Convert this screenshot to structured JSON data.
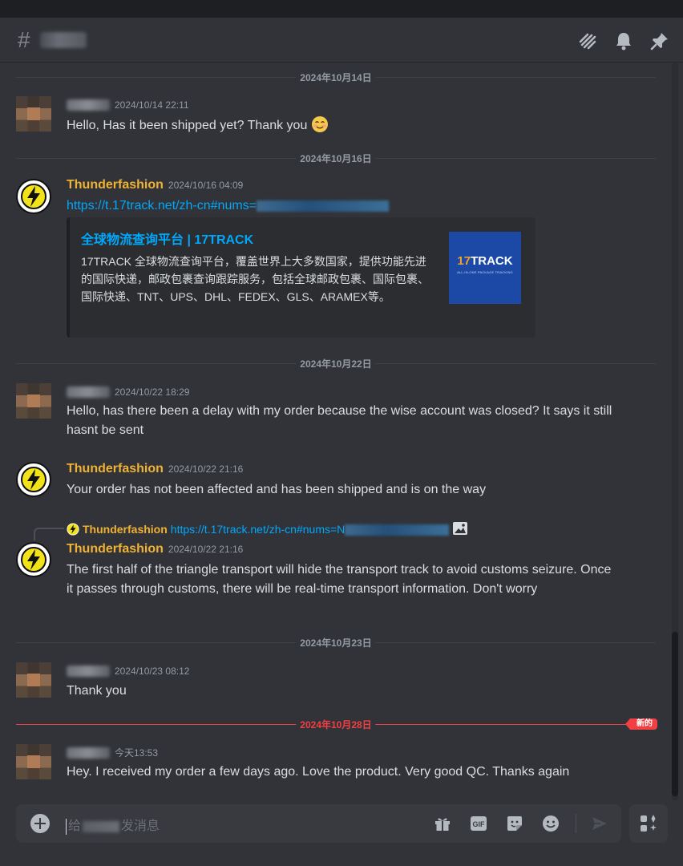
{
  "channel": {
    "hash": "#"
  },
  "messages": [
    {
      "date": "2024年10月14日",
      "timestamp": "2024/10/14 22:11",
      "text": "Hello, Has it been shipped yet? Thank you"
    },
    {
      "date": "2024年10月16日",
      "username": "Thunderfashion",
      "timestamp": "2024/10/16 04:09",
      "link": "https://t.17track.net/zh-cn#nums=",
      "embed": {
        "title": "全球物流查询平台 | 17TRACK",
        "description": "17TRACK 全球物流查询平台，覆盖世界上大多数国家，提供功能先进的国际快递，邮政包裹查询跟踪服务，包括全球邮政包裹、国际包裹、国际快递、TNT、UPS、DHL、FEDEX、GLS、ARAMEX等。",
        "thumb_logo_a": "17",
        "thumb_logo_b": "TRACK",
        "thumb_sub": "ALL-IN-ONE PACKAGE TRACKING"
      }
    },
    {
      "date": "2024年10月22日",
      "timestamp": "2024/10/22 18:29",
      "text": "Hello,  has there been a delay with my order because the wise account was closed? It says it still hasnt be sent"
    },
    {
      "username": "Thunderfashion",
      "timestamp": "2024/10/22 21:16",
      "text": "Your order has not been affected and has been shipped and is on the way"
    },
    {
      "reply": {
        "username": "Thunderfashion",
        "link": "https://t.17track.net/zh-cn#nums=N"
      },
      "username": "Thunderfashion",
      "timestamp": "2024/10/22 21:16",
      "text": "The first half of the triangle transport will hide the transport track to avoid customs seizure. Once it passes through customs, there will be real-time transport information. Don't worry"
    },
    {
      "date": "2024年10月23日",
      "timestamp": "2024/10/23 08:12",
      "text": "Thank you"
    },
    {
      "date": "2024年10月28日",
      "new_label": "新的",
      "timestamp": "今天13:53",
      "text": "Hey. I received my order a few days ago. Love the product. Very good QC. Thanks again"
    }
  ],
  "composer": {
    "placeholder_start": "给",
    "placeholder_end": "发消息"
  },
  "colors": {
    "accent_link": "#00a8fc",
    "username": "#f0b232",
    "new_divider": "#f23f43",
    "background": "#313338"
  }
}
